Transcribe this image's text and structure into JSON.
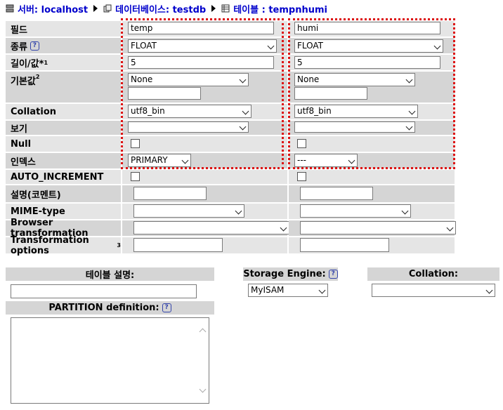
{
  "breadcrumb": {
    "server_label": "서버: localhost",
    "database_label": "데이터베이스: testdb",
    "table_label": "테이블 : tempnhumi"
  },
  "rows": {
    "field": "필드",
    "type": "종류",
    "length": "길이/값*",
    "length_sup": "1",
    "default": "기본값",
    "default_sup": "2",
    "collation": "Collation",
    "attributes": "보기",
    "null": "Null",
    "index": "인덱스",
    "auto_increment": "AUTO_INCREMENT",
    "comment": "설명(코멘트)",
    "mime": "MIME-type",
    "browser_transform": "Browser transformation",
    "transform_options": "Transformation options",
    "transform_options_sup": "3"
  },
  "col1": {
    "field": "temp",
    "type": "FLOAT",
    "length": "5",
    "default": "None",
    "collation": "utf8_bin",
    "index": "PRIMARY"
  },
  "col2": {
    "field": "humi",
    "type": "FLOAT",
    "length": "5",
    "default": "None",
    "collation": "utf8_bin",
    "index": "---"
  },
  "bottom": {
    "table_comment": "테이블 설명:",
    "storage_engine": "Storage Engine:",
    "storage_engine_value": "MyISAM",
    "collation": "Collation:",
    "partition": "PARTITION definition:"
  },
  "colors": {
    "link": "#0000cc",
    "highlight": "#dd1111",
    "row_light": "#e5e5e5",
    "row_dark": "#d5d5d5"
  }
}
